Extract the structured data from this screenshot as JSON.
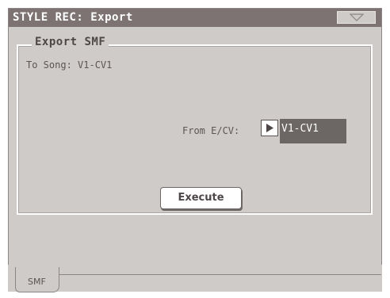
{
  "window": {
    "title": "STYLE REC: Export",
    "menu_icon": "triangle-down-icon"
  },
  "group": {
    "legend": "Export SMF",
    "to_song": "To Song:  V1-CV1"
  },
  "source": {
    "label": "From E/CV:",
    "play_icon": "play-icon",
    "value": "V1-CV1"
  },
  "actions": {
    "execute_label": "Execute"
  },
  "tabs": [
    {
      "label": "SMF",
      "selected": true
    }
  ],
  "colors": {
    "titlebar": "#7c7372",
    "panel": "#cfcbc8",
    "value_field": "#6c6665"
  }
}
